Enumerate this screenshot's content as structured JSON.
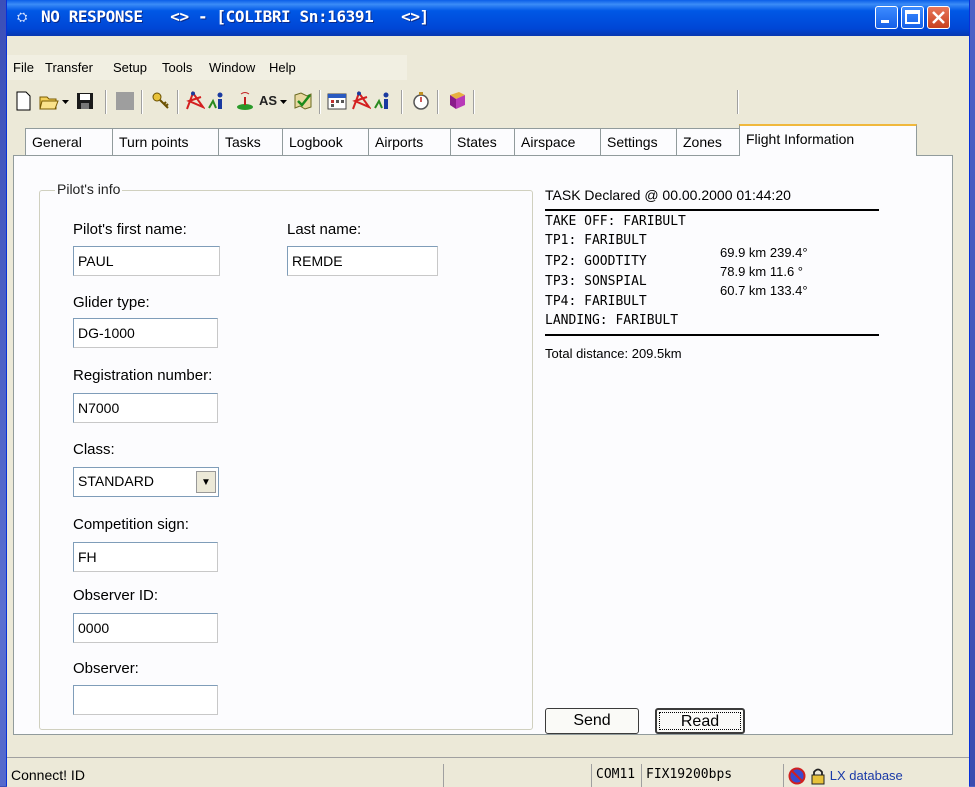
{
  "window": {
    "title": "NO RESPONSE   <> - [COLIBRI Sn:16391   <>]"
  },
  "menu": [
    "File",
    "Transfer",
    "Setup",
    "Tools",
    "Window",
    "Help"
  ],
  "toolbar": {
    "icons": [
      "new-document-icon",
      "open-folder-icon",
      "dropdown-arrow-icon",
      "save-disk-icon",
      "stop-square-icon",
      "key-icon",
      "flight-track-icon",
      "info-icon",
      "antenna-icon",
      "as-text-icon",
      "dropdown-arrow-icon",
      "map-check-icon",
      "calendar-icon",
      "flight-track-icon",
      "info-icon",
      "stopwatch-icon",
      "book-icon"
    ],
    "as_label": "AS"
  },
  "tabs": [
    "General",
    "Turn points",
    "Tasks",
    "Logbook",
    "Airports",
    "States",
    "Airspace",
    "Settings",
    "Zones",
    "Flight Information"
  ],
  "active_tab": "Flight Information",
  "pilot": {
    "group_title": "Pilot's info",
    "first_name_label": "Pilot's first name:",
    "first_name": "PAUL",
    "last_name_label": "Last name:",
    "last_name": "REMDE",
    "glider_label": "Glider type:",
    "glider": "DG-1000",
    "reg_label": "Registration number:",
    "reg": "N7000",
    "class_label": "Class:",
    "class_value": "STANDARD",
    "comp_label": "Competition sign:",
    "comp": "FH",
    "observer_id_label": "Observer ID:",
    "observer_id": "0000",
    "observer_label": "Observer:",
    "observer": ""
  },
  "task": {
    "declared": "TASK Declared @ 00.00.2000 01:44:20",
    "points": [
      "TAKE OFF: FARIBULT",
      "TP1: FARIBULT",
      "TP2: GOODTITY",
      "TP3: SONSPIAL",
      "TP4: FARIBULT",
      "LANDING: FARIBULT"
    ],
    "legs": [
      "69.9 km  239.4°",
      "78.9 km  11.6 °",
      "60.7 km  133.4°"
    ],
    "total": "Total distance: 209.5km"
  },
  "buttons": {
    "send": "Send",
    "read": "Read"
  },
  "status": {
    "connect": "Connect! ID",
    "port": "COM11",
    "baud": "FIX19200bps",
    "database": "LX database"
  },
  "colors": {
    "title_bar": "#0058e6",
    "tab_highlight": "#f0b83c",
    "panel": "#fcfcfe"
  }
}
